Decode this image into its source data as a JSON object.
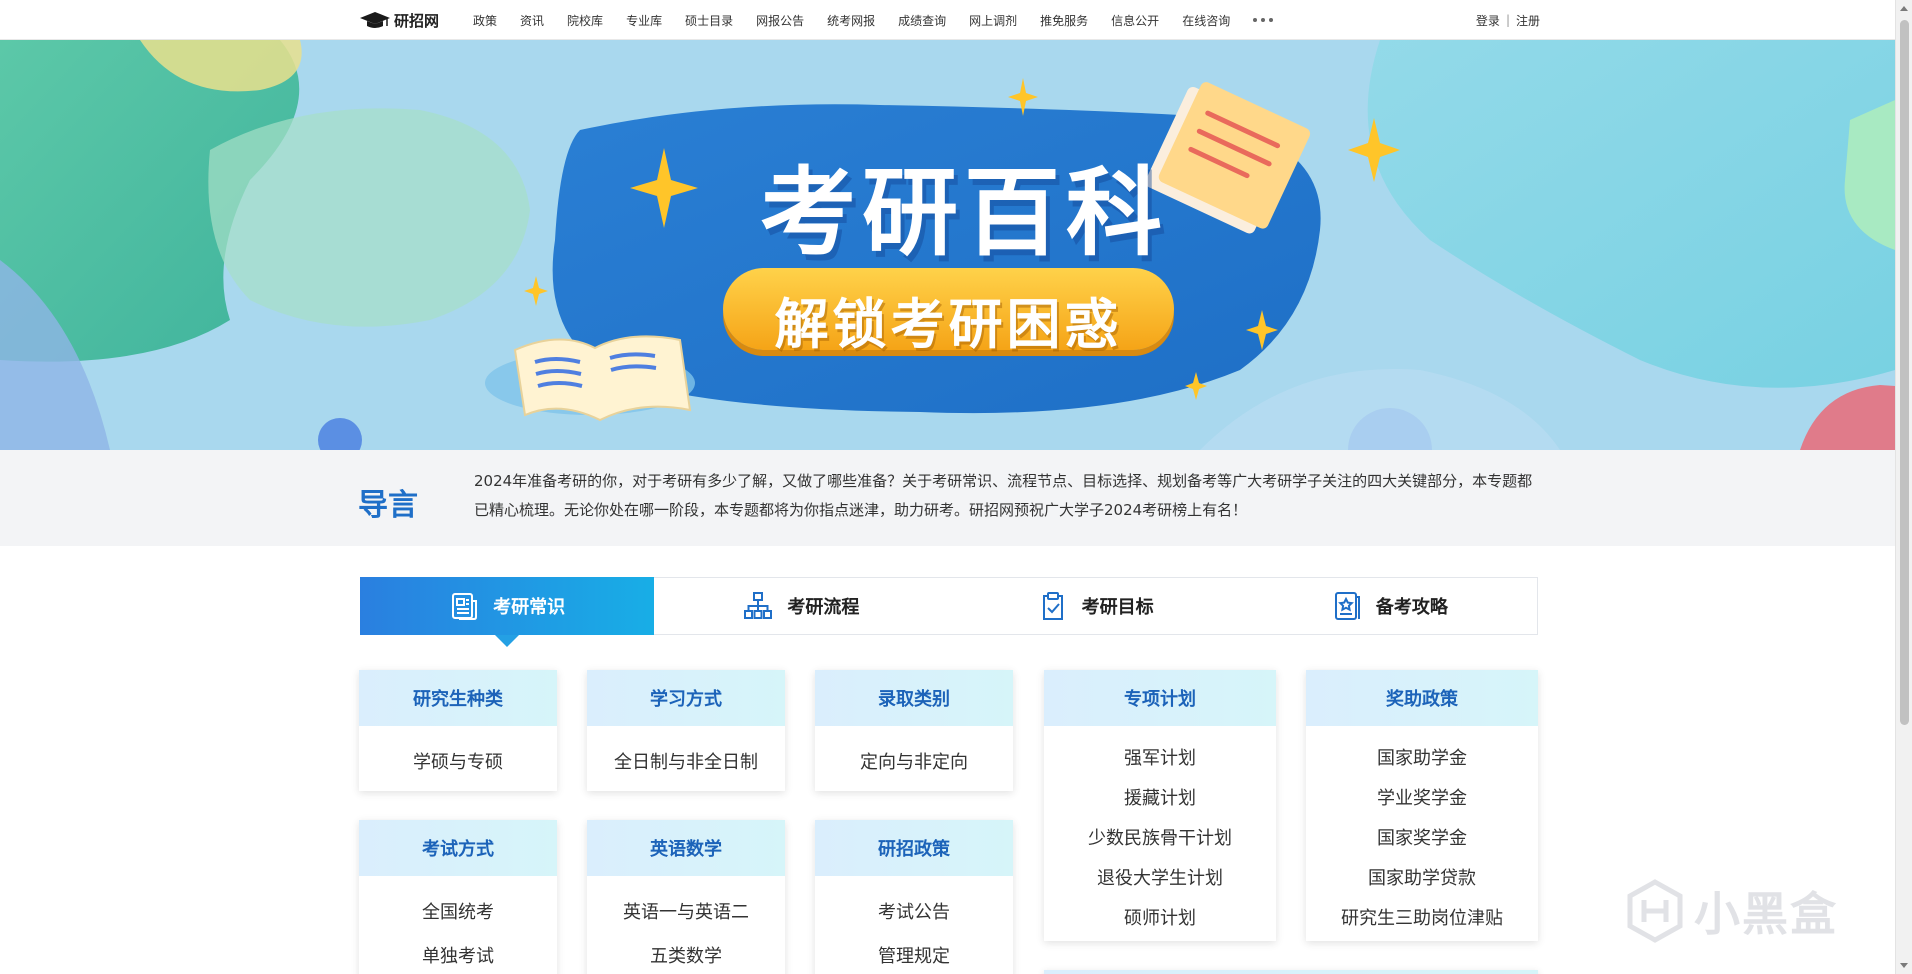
{
  "nav": {
    "logo_text": "研招网",
    "items": [
      "政策",
      "资讯",
      "院校库",
      "专业库",
      "硕士目录",
      "网报公告",
      "统考网报",
      "成绩查询",
      "网上调剂",
      "推免服务",
      "信息公开",
      "在线咨询"
    ],
    "login": "登录",
    "separator": "|",
    "register": "注册"
  },
  "banner": {
    "title": "考研百科",
    "subtitle": "解锁考研困惑"
  },
  "intro": {
    "title": "导言",
    "text": "2024年准备考研的你，对于考研有多少了解，又做了哪些准备？关于考研常识、流程节点、目标选择、规划备考等广大考研学子关注的四大关键部分，本专题都已精心梳理。无论你处在哪一阶段，本专题都将为你指点迷津，助力研考。研招网预祝广大学子2024考研榜上有名！"
  },
  "tabs": [
    {
      "label": "考研常识",
      "icon": "news-icon"
    },
    {
      "label": "考研流程",
      "icon": "flowchart-icon"
    },
    {
      "label": "考研目标",
      "icon": "clipboard-check-icon"
    },
    {
      "label": "备考攻略",
      "icon": "star-book-icon"
    }
  ],
  "cards": {
    "types": {
      "title": "研究生种类",
      "items": [
        "学硕与专硕"
      ]
    },
    "study": {
      "title": "学习方式",
      "items": [
        "全日制与非全日制"
      ]
    },
    "admit": {
      "title": "录取类别",
      "items": [
        "定向与非定向"
      ]
    },
    "special": {
      "title": "专项计划",
      "items": [
        "强军计划",
        "援藏计划",
        "少数民族骨干计划",
        "退役大学生计划",
        "硕师计划"
      ]
    },
    "aid": {
      "title": "奖助政策",
      "items": [
        "国家助学金",
        "学业奖学金",
        "国家奖学金",
        "国家助学贷款",
        "研究生三助岗位津贴"
      ]
    },
    "exam": {
      "title": "考试方式",
      "items": [
        "全国统考",
        "单独考试"
      ]
    },
    "english_math": {
      "title": "英语数学",
      "items": [
        "英语一与英语二",
        "五类数学"
      ]
    },
    "policy": {
      "title": "研招政策",
      "items": [
        "考试公告",
        "管理规定"
      ]
    }
  },
  "watermark": "小黑盒",
  "colors": {
    "accent": "#1f6fc8",
    "tab_active_start": "#2a7fe0",
    "tab_active_end": "#18aee6",
    "pill": "#f5a417"
  }
}
